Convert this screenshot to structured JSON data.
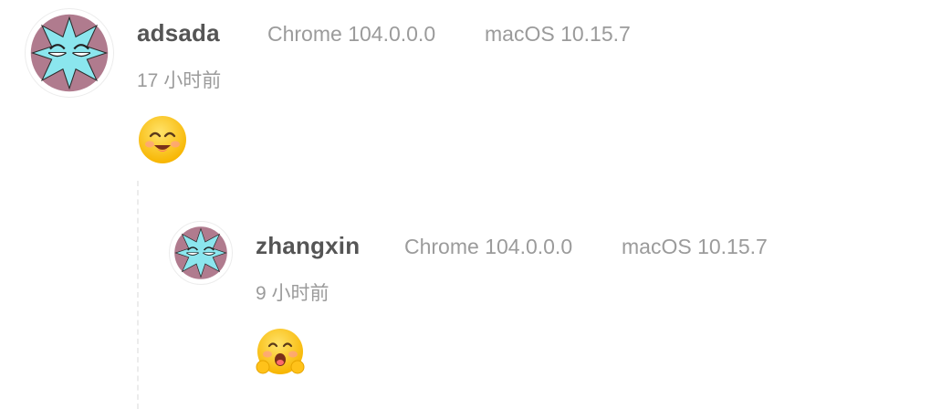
{
  "comments": [
    {
      "author": "adsada",
      "browser": "Chrome 104.0.0.0",
      "os": "macOS 10.15.7",
      "time": "17 小时前",
      "emoji": "smile-emoji",
      "avatar_icon": "star-face-avatar-icon"
    },
    {
      "author": "zhangxin",
      "browser": "Chrome 104.0.0.0",
      "os": "macOS 10.15.7",
      "time": "9 小时前",
      "emoji": "hug-emoji",
      "avatar_icon": "star-face-avatar-icon"
    }
  ],
  "colors": {
    "avatar_bg": "#b07b8e",
    "avatar_star": "#8be6ee",
    "name": "#555555",
    "meta": "#9b9b9b",
    "emoji_face": "#ffd23a"
  }
}
